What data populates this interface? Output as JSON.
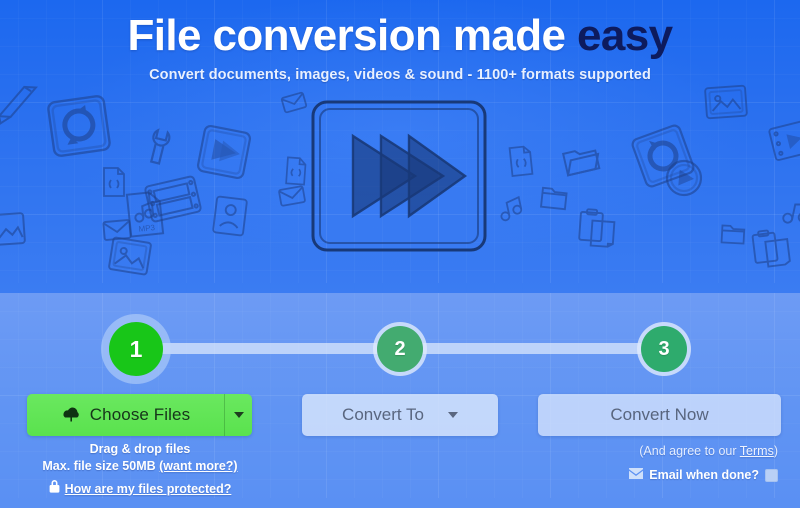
{
  "hero": {
    "headline_main": "File conversion made ",
    "headline_accent": "easy",
    "subheadline": "Convert documents, images, videos & sound - 1100+ formats supported",
    "main_illustration": "fast-forward-sketch-icon",
    "background_doodles": [
      "pencil-doodle",
      "refresh-square-doodle",
      "wrench-doodle",
      "mp3-file-doodle",
      "code-file-doodle",
      "envelope-doodle",
      "film-strip-doodle",
      "play-square-doodle",
      "id-card-doodle",
      "photo-frame-doodle",
      "folder-doodle",
      "music-note-doodle",
      "play-circle-doodle",
      "clipboard-copy-doodle",
      "refresh-circle-doodle",
      "video-frame-doodle",
      "image-doodle"
    ]
  },
  "steps": [
    {
      "number": "1",
      "state": "active"
    },
    {
      "number": "2",
      "state": "pending"
    },
    {
      "number": "3",
      "state": "pending"
    }
  ],
  "actions": {
    "choose_files_label": "Choose Files",
    "choose_files_icon": "cloud-upload-icon",
    "choose_files_caret_icon": "caret-down-icon",
    "convert_to_label": "Convert To",
    "convert_to_caret_icon": "caret-down-icon",
    "convert_now_label": "Convert Now"
  },
  "left_help": {
    "drag_drop": "Drag & drop files",
    "max_size_prefix": "Max. file size 50MB ",
    "want_more_link": "(want more?)",
    "lock_icon": "lock-icon",
    "protected_link": "How are my files protected?"
  },
  "right_help": {
    "agree_prefix": "(And agree to our ",
    "terms_link": "Terms",
    "agree_suffix": ")",
    "mail_icon": "envelope-icon",
    "email_when_done": "Email when done?",
    "checkbox_checked": false
  },
  "colors": {
    "hero_top": "#1c68ef",
    "hero_bottom": "#3b7cf2",
    "lower_panel": "#6094f3",
    "accent_navy": "#0d1b5e",
    "step_active_green": "#18c618",
    "step_pending_green": "#2eab6d",
    "choose_button_green": "#5ae24e",
    "disabled_button": "#d6e4fc"
  }
}
